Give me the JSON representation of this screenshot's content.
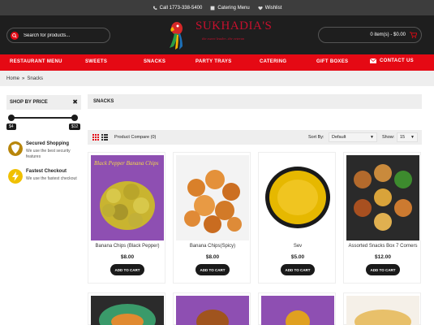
{
  "topbar": {
    "phone": "Call 1773-338-5400",
    "catering_menu": "Catering Menu",
    "wishlist": "Wishlist"
  },
  "header": {
    "search_placeholder": "Search for products...",
    "logo_name": "SUKHADIA'S",
    "logo_tagline": "the sweet leader...the veteran",
    "cart_summary": "0 item(s) - $0.00"
  },
  "nav": [
    "RESTAURANT MENU",
    "SWEETS",
    "SNACKS",
    "PARTY TRAYS",
    "CATERING",
    "GIFT BOXES",
    "CONTACT US"
  ],
  "breadcrumb": {
    "home": "Home",
    "separator": "»",
    "current": "Snacks"
  },
  "sidebar": {
    "price_title": "SHOP BY PRICE",
    "price_close": "✖",
    "price_min": "$4",
    "price_max": "$12",
    "features": [
      {
        "title": "Secured Shopping",
        "desc": "We use the best security features",
        "icon": "shield-icon",
        "color": "#b8860b"
      },
      {
        "title": "Fastest Checkout",
        "desc": "We use the fastest checkout",
        "icon": "lightning-icon",
        "color": "#f0c000"
      }
    ]
  },
  "main": {
    "title": "SNACKS",
    "compare": "Product Compare (0)",
    "sort_label": "Sort By:",
    "sort_value": "Default",
    "show_label": "Show:",
    "show_value": "15"
  },
  "products": [
    {
      "name": "Banana Chips (Black Pepper)",
      "price": "$8.00",
      "button": "ADD TO CART",
      "image_text": "Black Pepper Banana Chips"
    },
    {
      "name": "Banana Chips(Spicy)",
      "price": "$8.00",
      "button": "ADD TO CART"
    },
    {
      "name": "Sev",
      "price": "$5.00",
      "button": "ADD TO CART"
    },
    {
      "name": "Assorted Snacks Box 7 Corners",
      "price": "$12.00",
      "button": "ADD TO CART"
    }
  ],
  "colors": {
    "brand_red": "#e50914",
    "header_dark": "#1e1e1e",
    "topbar": "#3d3d3d"
  }
}
